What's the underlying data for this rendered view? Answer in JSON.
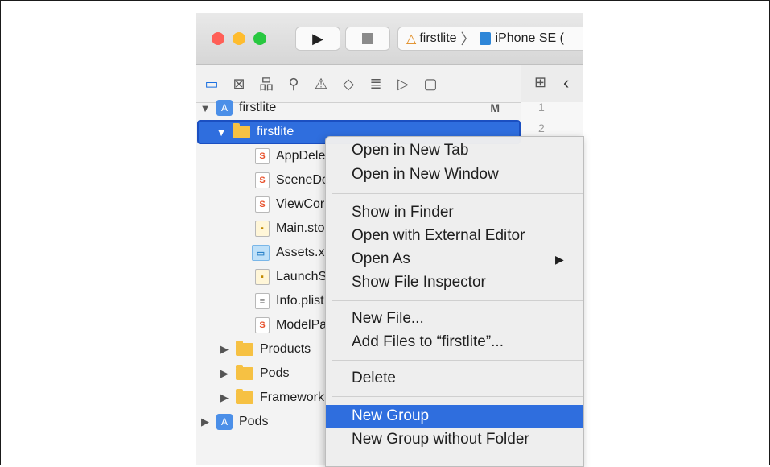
{
  "toolbar": {
    "traffic_colors": [
      "#ff5f57",
      "#febc2e",
      "#28c840"
    ],
    "run_icon": "play-icon",
    "stop_icon": "stop-icon",
    "scheme_name": "firstlite",
    "destination": "iPhone SE ("
  },
  "navigator": {
    "icons": [
      "folder-icon",
      "source-control-icon",
      "hierarchy-icon",
      "search-icon",
      "warning-icon",
      "test-icon",
      "debug-icon",
      "breakpoint-icon",
      "report-icon"
    ]
  },
  "tree": {
    "root": {
      "label": "firstlite",
      "badge": "M"
    },
    "group": {
      "label": "firstlite"
    },
    "files": [
      "AppDele",
      "SceneDe",
      "ViewCor",
      "Main.sto",
      "Assets.x",
      "LaunchS",
      "Info.plist",
      "ModelPa"
    ],
    "folders": [
      "Products",
      "Pods",
      "Framework"
    ],
    "pods_project": "Pods"
  },
  "editor": {
    "line_numbers": [
      "1",
      "2"
    ]
  },
  "menu": {
    "items": {
      "open_new_tab": "Open in New Tab",
      "open_new_window": "Open in New Window",
      "show_in_finder": "Show in Finder",
      "open_external": "Open with External Editor",
      "open_as": "Open As",
      "show_inspector": "Show File Inspector",
      "new_file": "New File...",
      "add_files": "Add Files to “firstlite”...",
      "delete": "Delete",
      "new_group": "New Group",
      "new_group_no_folder": "New Group without Folder"
    },
    "highlight_color": "#2f6ede"
  }
}
